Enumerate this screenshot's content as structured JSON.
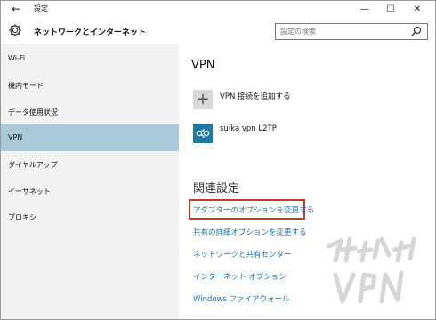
{
  "window": {
    "title": "設定",
    "back_icon": "←",
    "min_icon": "—",
    "max_icon": "☐",
    "close_icon": "✕"
  },
  "header": {
    "title": "ネットワークとインターネット",
    "search_placeholder": "設定の検索"
  },
  "sidebar": {
    "items": [
      {
        "label": "Wi-Fi"
      },
      {
        "label": "機内モード"
      },
      {
        "label": "データ使用状況"
      },
      {
        "label": "VPN"
      },
      {
        "label": "ダイヤルアップ"
      },
      {
        "label": "イーサネット"
      },
      {
        "label": "プロキシ"
      }
    ],
    "active": "VPN"
  },
  "main": {
    "title": "VPN",
    "add_vpn_label": "VPN 接続を追加する",
    "add_vpn_icon": "+",
    "connection_name": "suika vpn L2TP",
    "related_title": "関連設定",
    "links": [
      "アダプターのオプションを変更する",
      "共有の詳細オプションを変更する",
      "ネットワークと共有センター",
      "インターネット オプション",
      "Windows ファイアウォール"
    ]
  },
  "colors": {
    "sidebar_bg": "#f2f2f2",
    "active_item": "#a9c9d8",
    "link": "#1a6fb0",
    "highlight": "#c43b2b",
    "vpn_tile": "#1a7ba5"
  }
}
